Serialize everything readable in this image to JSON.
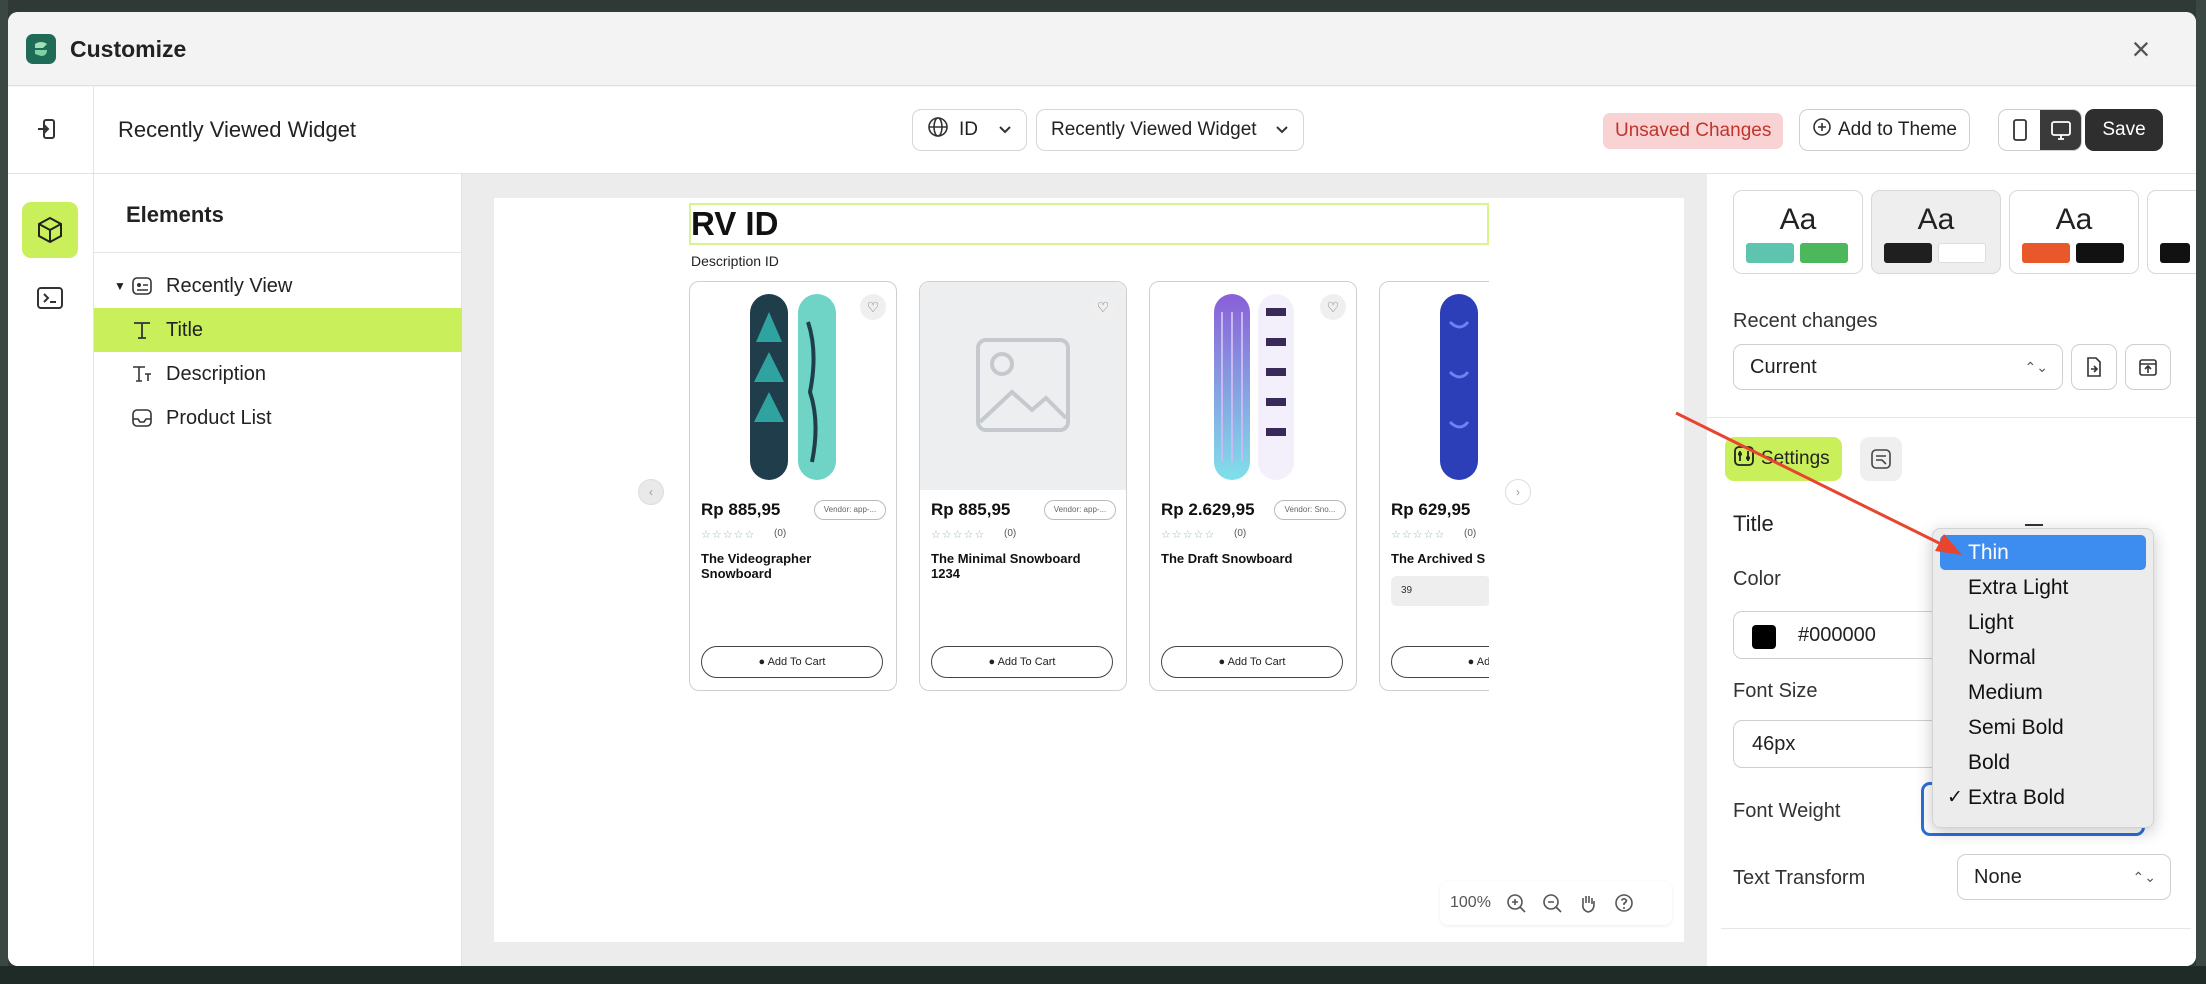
{
  "window": {
    "title": "Customize"
  },
  "toolbar": {
    "page_name": "Recently Viewed Widget",
    "language": "ID",
    "template": "Recently Viewed Widget",
    "unsaved": "Unsaved Changes",
    "add_to_theme": "Add to Theme",
    "save": "Save"
  },
  "elements": {
    "title": "Elements",
    "root": "Recently View",
    "children": [
      "Title",
      "Description",
      "Product List"
    ]
  },
  "preview": {
    "title": "RV ID",
    "description": "Description ID",
    "products": [
      {
        "price": "Rp 885,95",
        "vendor": "Vendor: app-...",
        "reviews": "(0)",
        "name": "The Videographer Snowboard",
        "cart": "Add To Cart"
      },
      {
        "price": "Rp 885,95",
        "vendor": "Vendor: app-...",
        "reviews": "(0)",
        "name": "The Minimal Snowboard 1234",
        "cart": "Add To Cart"
      },
      {
        "price": "Rp 2.629,95",
        "vendor": "Vendor: Sno...",
        "reviews": "(0)",
        "name": "The Draft Snowboard",
        "cart": "Add To Cart"
      },
      {
        "price": "Rp 629,95",
        "vendor": "",
        "reviews": "(0)",
        "name": "The Archived S",
        "qty": "39",
        "cart": "Add"
      }
    ],
    "stars": "☆☆☆☆☆",
    "zoom": "100%"
  },
  "right_panel": {
    "theme_sample": "Aa",
    "theme_colors": [
      [
        "#5fc4ae",
        "#4cb75b"
      ],
      [
        "#1f1f1f",
        "#ffffff"
      ],
      [
        "#e9582a",
        "#111111"
      ]
    ],
    "recent_changes_label": "Recent changes",
    "recent_changes_value": "Current",
    "settings_tab": "Settings",
    "section_title": "Title",
    "color_label": "Color",
    "color_value": "#000000",
    "font_size_label": "Font Size",
    "font_size_value": "46px",
    "font_weight_label": "Font Weight",
    "text_transform_label": "Text Transform",
    "text_transform_value": "None"
  },
  "dropdown": {
    "options": [
      "Thin",
      "Extra Light",
      "Light",
      "Normal",
      "Medium",
      "Semi Bold",
      "Bold",
      "Extra Bold"
    ],
    "highlighted": "Thin",
    "checked": "Extra Bold",
    "check_mark": "✓"
  },
  "colors": {
    "accent": "#c9f05a",
    "annotation_arrow": "#e8452f",
    "highlight": "#3d8cf0"
  }
}
